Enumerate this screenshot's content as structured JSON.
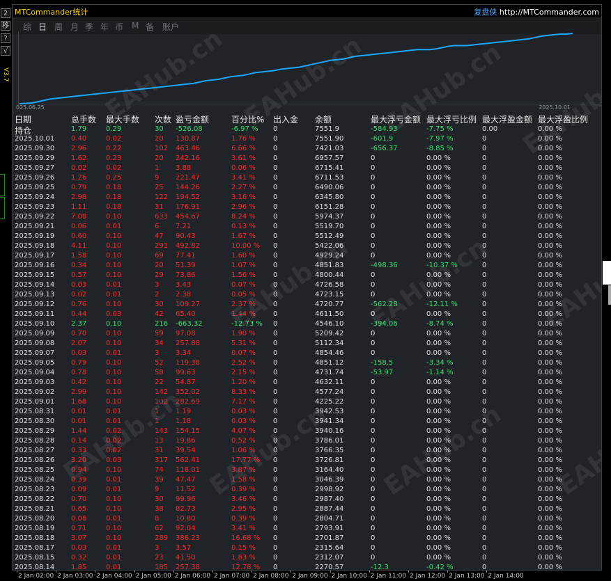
{
  "app_title": "MTCommander统计",
  "brand_name": "复盘侠",
  "brand_url": "http://MTCommander.com",
  "version": "V3.7",
  "watermark": "EAHub.cn",
  "left_buttons": [
    "2",
    "移",
    "?",
    "√"
  ],
  "tabs": [
    "综",
    "日",
    "周",
    "月",
    "季",
    "年",
    "币",
    "M",
    "备",
    "账户"
  ],
  "active_tab": "日",
  "chart": {
    "start_label": "025.06.25",
    "end_label": "2025.10.01",
    "line_color": "#1ea7ff"
  },
  "chart_data": {
    "type": "line",
    "x_labels": [
      "025.06.25",
      "2025.10.01"
    ],
    "series": [
      {
        "values": [
          0,
          0.5,
          1,
          3,
          5,
          7,
          8,
          9,
          10,
          11,
          12,
          13,
          14,
          15,
          16,
          17,
          18,
          19,
          20,
          21,
          22,
          23,
          24,
          25,
          26,
          27,
          28,
          29,
          30,
          32,
          34,
          35,
          36,
          38,
          40,
          41,
          42,
          44,
          46,
          47,
          48,
          49,
          51,
          52,
          53,
          54,
          56,
          58,
          60,
          62,
          64,
          65,
          66,
          68,
          70,
          71,
          72,
          73,
          74,
          75,
          76,
          77,
          78,
          79,
          80,
          80,
          80,
          81,
          83,
          85,
          86,
          86,
          86,
          87,
          88,
          89,
          90,
          91,
          92,
          93,
          94,
          95,
          96,
          98,
          100,
          101,
          102,
          103,
          103,
          104
        ]
      }
    ]
  },
  "headers": [
    "日期",
    "总手数",
    "最大手数",
    "次数",
    "盈亏金额",
    "百分比%",
    "出入金",
    "余额",
    "最大浮亏金额",
    "最大浮亏比例",
    "最大浮盈金额",
    "最大浮盈比例"
  ],
  "holding": {
    "label": "持仓",
    "total_lots": "1.79",
    "max_lots": "0.29",
    "count": "30",
    "pnl": "-526.08",
    "pct": "-6.97 %",
    "inout": "0",
    "balance": "7551.9",
    "max_float_loss": "-584.93",
    "max_float_loss_pct": "-7.75 %",
    "max_float_profit": "0.00",
    "max_float_profit_pct": "0.00 %"
  },
  "rows": [
    [
      "2025.10.01",
      "0.40",
      "0.02",
      "20",
      "130.87",
      "1.76 %",
      "0",
      "7551.90",
      "-601.9",
      "-7.97 %",
      "0",
      "0.00 %"
    ],
    [
      "2025.09.30",
      "2.96",
      "0.22",
      "102",
      "463.46",
      "6.66 %",
      "0",
      "7421.03",
      "-656.37",
      "-8.85 %",
      "0",
      "0.00 %"
    ],
    [
      "2025.09.29",
      "1.62",
      "0.23",
      "20",
      "242.16",
      "3.61 %",
      "0",
      "6957.57",
      "0",
      "0.00 %",
      "0",
      "0.00 %"
    ],
    [
      "2025.09.27",
      "0.02",
      "0.02",
      "1",
      "3.88",
      "0.06 %",
      "0",
      "6715.41",
      "0",
      "0.00 %",
      "0",
      "0.00 %"
    ],
    [
      "2025.09.26",
      "1.26",
      "0.25",
      "9",
      "221.47",
      "3.41 %",
      "0",
      "6711.53",
      "0",
      "0.00 %",
      "0",
      "0.00 %"
    ],
    [
      "2025.09.25",
      "0.79",
      "0.18",
      "25",
      "144.26",
      "2.27 %",
      "0",
      "6490.06",
      "0",
      "0.00 %",
      "0",
      "0.00 %"
    ],
    [
      "2025.09.24",
      "2.98",
      "0.18",
      "122",
      "194.52",
      "3.16 %",
      "0",
      "6345.80",
      "0",
      "0.00 %",
      "0",
      "0.00 %"
    ],
    [
      "2025.09.23",
      "1.11",
      "0.18",
      "31",
      "176.91",
      "2.96 %",
      "0",
      "6151.28",
      "0",
      "0.00 %",
      "0",
      "0.00 %"
    ],
    [
      "2025.09.22",
      "7.08",
      "0.10",
      "633",
      "454.67",
      "8.24 %",
      "0",
      "5974.37",
      "0",
      "0.00 %",
      "0",
      "0.00 %"
    ],
    [
      "2025.09.21",
      "0.06",
      "0.01",
      "6",
      "7.21",
      "0.13 %",
      "0",
      "5519.70",
      "0",
      "0.00 %",
      "0",
      "0.00 %"
    ],
    [
      "2025.09.19",
      "0.60",
      "0.10",
      "47",
      "90.43",
      "1.67 %",
      "0",
      "5512.49",
      "0",
      "0.00 %",
      "0",
      "0.00 %"
    ],
    [
      "2025.09.18",
      "4.11",
      "0.10",
      "291",
      "492.82",
      "10.00 %",
      "0",
      "5422.06",
      "0",
      "0.00 %",
      "0",
      "0.00 %"
    ],
    [
      "2025.09.17",
      "1.58",
      "0.10",
      "69",
      "77.41",
      "1.60 %",
      "0",
      "4929.24",
      "0",
      "0.00 %",
      "0",
      "0.00 %"
    ],
    [
      "2025.09.16",
      "0.34",
      "0.10",
      "20",
      "51.39",
      "1.07 %",
      "0",
      "4851.83",
      "-498.36",
      "-10.37 %",
      "0",
      "0.00 %"
    ],
    [
      "2025.09.15",
      "0.57",
      "0.10",
      "29",
      "73.86",
      "1.56 %",
      "0",
      "4800.44",
      "0",
      "0.00 %",
      "0",
      "0.00 %"
    ],
    [
      "2025.09.14",
      "0.03",
      "0.01",
      "3",
      "3.43",
      "0.07 %",
      "0",
      "4726.58",
      "0",
      "0.00 %",
      "0",
      "0.00 %"
    ],
    [
      "2025.09.13",
      "0.02",
      "0.01",
      "2",
      "2.38",
      "0.05 %",
      "0",
      "4723.15",
      "0",
      "0.00 %",
      "0",
      "0.00 %"
    ],
    [
      "2025.09.12",
      "0.76",
      "0.10",
      "30",
      "109.27",
      "2.37 %",
      "0",
      "4720.77",
      "-562.28",
      "-12.11 %",
      "0",
      "0.00 %"
    ],
    [
      "2025.09.11",
      "0.44",
      "0.03",
      "42",
      "65.40",
      "1.44 %",
      "0",
      "4611.50",
      "0",
      "0.00 %",
      "0",
      "0.00 %"
    ],
    [
      "2025.09.10",
      "2.37",
      "0.10",
      "216",
      "-663.32",
      "-12.73 %",
      "0",
      "4546.10",
      "-394.06",
      "-8.74 %",
      "0",
      "0.00 %"
    ],
    [
      "2025.09.09",
      "0.70",
      "0.10",
      "59",
      "97.08",
      "1.90 %",
      "0",
      "5209.42",
      "0",
      "0.00 %",
      "0",
      "0.00 %"
    ],
    [
      "2025.09.08",
      "2.07",
      "0.10",
      "34",
      "257.88",
      "5.31 %",
      "0",
      "5112.34",
      "0",
      "0.00 %",
      "0",
      "0.00 %"
    ],
    [
      "2025.09.07",
      "0.03",
      "0.01",
      "3",
      "3.34",
      "0.07 %",
      "0",
      "4854.46",
      "0",
      "0.00 %",
      "0",
      "0.00 %"
    ],
    [
      "2025.09.05",
      "0.79",
      "0.10",
      "52",
      "119.38",
      "2.52 %",
      "0",
      "4851.12",
      "-158.5",
      "-3.34 %",
      "0",
      "0.00 %"
    ],
    [
      "2025.09.04",
      "0.78",
      "0.10",
      "58",
      "99.63",
      "2.15 %",
      "0",
      "4731.74",
      "-53.97",
      "-1.14 %",
      "0",
      "0.00 %"
    ],
    [
      "2025.09.03",
      "0.42",
      "0.10",
      "22",
      "54.87",
      "1.20 %",
      "0",
      "4632.11",
      "0",
      "0.00 %",
      "0",
      "0.00 %"
    ],
    [
      "2025.09.02",
      "2.99",
      "0.10",
      "142",
      "352.02",
      "8.33 %",
      "0",
      "4577.24",
      "0",
      "0.00 %",
      "0",
      "0.00 %"
    ],
    [
      "2025.09.01",
      "1.68",
      "0.10",
      "102",
      "282.69",
      "7.17 %",
      "0",
      "4225.22",
      "0",
      "0.00 %",
      "0",
      "0.00 %"
    ],
    [
      "2025.08.31",
      "0.01",
      "0.01",
      "1",
      "1.19",
      "0.03 %",
      "0",
      "3942.53",
      "0",
      "0.00 %",
      "0",
      "0.00 %"
    ],
    [
      "2025.08.30",
      "0.01",
      "0.01",
      "1",
      "1.18",
      "0.03 %",
      "0",
      "3941.34",
      "0",
      "0.00 %",
      "0",
      "0.00 %"
    ],
    [
      "2025.08.29",
      "1.44",
      "0.02",
      "143",
      "154.15",
      "4.07 %",
      "0",
      "3940.16",
      "0",
      "0.00 %",
      "0",
      "0.00 %"
    ],
    [
      "2025.08.28",
      "0.14",
      "0.02",
      "13",
      "19.86",
      "0.52 %",
      "0",
      "3786.01",
      "0",
      "0.00 %",
      "0",
      "0.00 %"
    ],
    [
      "2025.08.27",
      "0.33",
      "0.02",
      "31",
      "39.54",
      "1.06 %",
      "0",
      "3766.35",
      "0",
      "0.00 %",
      "0",
      "0.00 %"
    ],
    [
      "2025.08.26",
      "3.20",
      "0.03",
      "317",
      "562.41",
      "17.77 %",
      "0",
      "3726.81",
      "0",
      "0.00 %",
      "0",
      "0.00 %"
    ],
    [
      "2025.08.25",
      "0.94",
      "0.10",
      "74",
      "118.01",
      "3.87 %",
      "0",
      "3164.40",
      "0",
      "0.00 %",
      "0",
      "0.00 %"
    ],
    [
      "2025.08.24",
      "0.39",
      "0.01",
      "39",
      "47.47",
      "1.58 %",
      "0",
      "3046.39",
      "0",
      "0.00 %",
      "0",
      "0.00 %"
    ],
    [
      "2025.08.23",
      "0.09",
      "0.01",
      "9",
      "11.52",
      "0.39 %",
      "0",
      "2998.92",
      "0",
      "0.00 %",
      "0",
      "0.00 %"
    ],
    [
      "2025.08.22",
      "0.70",
      "0.10",
      "30",
      "99.96",
      "3.46 %",
      "0",
      "2987.40",
      "0",
      "0.00 %",
      "0",
      "0.00 %"
    ],
    [
      "2025.08.21",
      "0.65",
      "0.10",
      "38",
      "82.73",
      "2.95 %",
      "0",
      "2887.44",
      "0",
      "0.00 %",
      "0",
      "0.00 %"
    ],
    [
      "2025.08.20",
      "0.08",
      "0.01",
      "8",
      "10.80",
      "0.39 %",
      "0",
      "2804.71",
      "0",
      "0.00 %",
      "0",
      "0.00 %"
    ],
    [
      "2025.08.19",
      "0.71",
      "0.10",
      "62",
      "92.04",
      "3.41 %",
      "0",
      "2793.91",
      "0",
      "0.00 %",
      "0",
      "0.00 %"
    ],
    [
      "2025.08.18",
      "3.07",
      "0.10",
      "289",
      "386.23",
      "16.68 %",
      "0",
      "2701.87",
      "0",
      "0.00 %",
      "0",
      "0.00 %"
    ],
    [
      "2025.08.17",
      "0.03",
      "0.01",
      "3",
      "3.57",
      "0.15 %",
      "0",
      "2315.64",
      "0",
      "0.00 %",
      "0",
      "0.00 %"
    ],
    [
      "2025.08.15",
      "0.32",
      "0.01",
      "23",
      "41.50",
      "1.83 %",
      "0",
      "2312.07",
      "0",
      "0.00 %",
      "0",
      "0.00 %"
    ],
    [
      "2025.08.14",
      "1.85",
      "0.01",
      "185",
      "257.38",
      "12.78 %",
      "0",
      "2270.57",
      "-12.3",
      "-0.42 %",
      "0",
      "0.00 %"
    ]
  ],
  "time_axis": [
    "2 Jan 02:00",
    "2 Jan 03:00",
    "2 Jan 04:00",
    "2 Jan 05:00",
    "2 Jan 06:00",
    "2 Jan 07:00",
    "2 Jan 08:00",
    "2 Jan 09:00",
    "2 Jan 10:00",
    "2 Jan 11:00",
    "2 Jan 12:00",
    "2 Jan 13:00",
    "2 Jan 14:00"
  ],
  "colors": {
    "profit": "#ff2a2a",
    "loss": "#33e36b",
    "title": "#ffd400",
    "brand": "#4da6ff"
  }
}
